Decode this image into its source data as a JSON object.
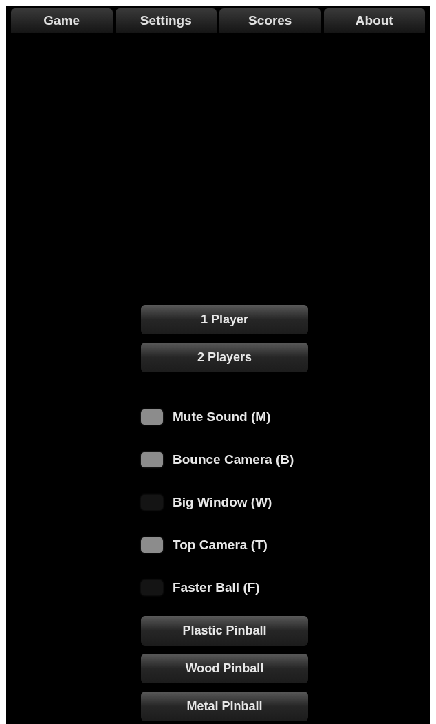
{
  "tabs": [
    {
      "label": "Game"
    },
    {
      "label": "Settings"
    },
    {
      "label": "Scores"
    },
    {
      "label": "About"
    }
  ],
  "player_buttons": [
    "1 Player",
    "2 Players"
  ],
  "options": [
    {
      "label": "Mute Sound (M)",
      "checked": true
    },
    {
      "label": "Bounce Camera (B)",
      "checked": true
    },
    {
      "label": "Big Window (W)",
      "checked": false
    },
    {
      "label": "Top Camera (T)",
      "checked": true
    },
    {
      "label": "Faster Ball (F)",
      "checked": false
    }
  ],
  "table_buttons": [
    "Plastic Pinball",
    "Wood Pinball",
    "Metal Pinball"
  ]
}
